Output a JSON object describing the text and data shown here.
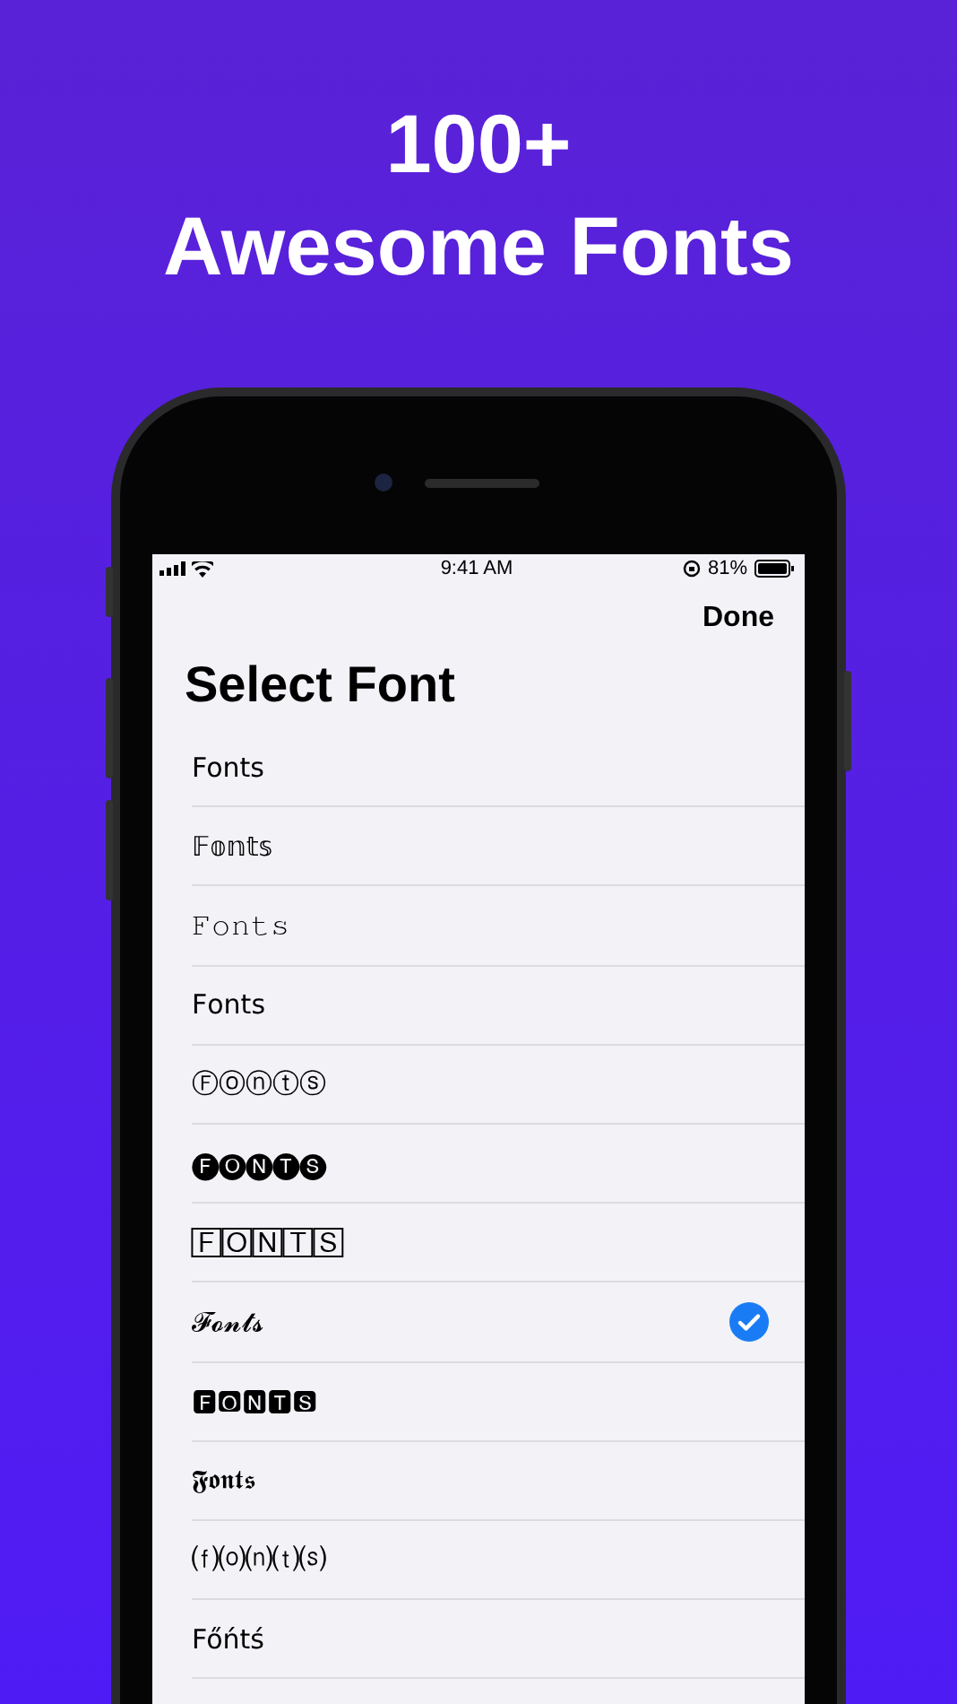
{
  "headline": [
    "100+",
    "Awesome Fonts"
  ],
  "status_bar": {
    "time": "9:41 AM",
    "battery": "81%"
  },
  "nav": {
    "done": "Done",
    "title": "Select Font"
  },
  "fonts": [
    {
      "sample": "Fonts",
      "selected": false
    },
    {
      "sample": "𝔽𝕠𝕟𝕥𝕤",
      "selected": false
    },
    {
      "sample": "𝙵𝚘𝚗𝚝𝚜",
      "selected": false
    },
    {
      "sample": "𝖥𝗈𝗇𝗍𝗌",
      "selected": false
    },
    {
      "sample": "Ⓕⓞⓝⓣⓢ",
      "selected": false
    },
    {
      "sample": "🅕🅞🅝🅣🅢",
      "selected": false
    },
    {
      "sample": "🄵🄾🄽🅃🅂",
      "selected": false
    },
    {
      "sample": "𝓕𝓸𝓷𝓽𝓼",
      "selected": true
    },
    {
      "sample": "🅵🅾🅽🆃🆂",
      "selected": false
    },
    {
      "sample": "𝕱𝖔𝖓𝖙𝖘",
      "selected": false
    },
    {
      "sample": "⒡⒪⒩⒯⒮",
      "selected": false
    },
    {
      "sample": "Főńtś",
      "selected": false
    }
  ]
}
